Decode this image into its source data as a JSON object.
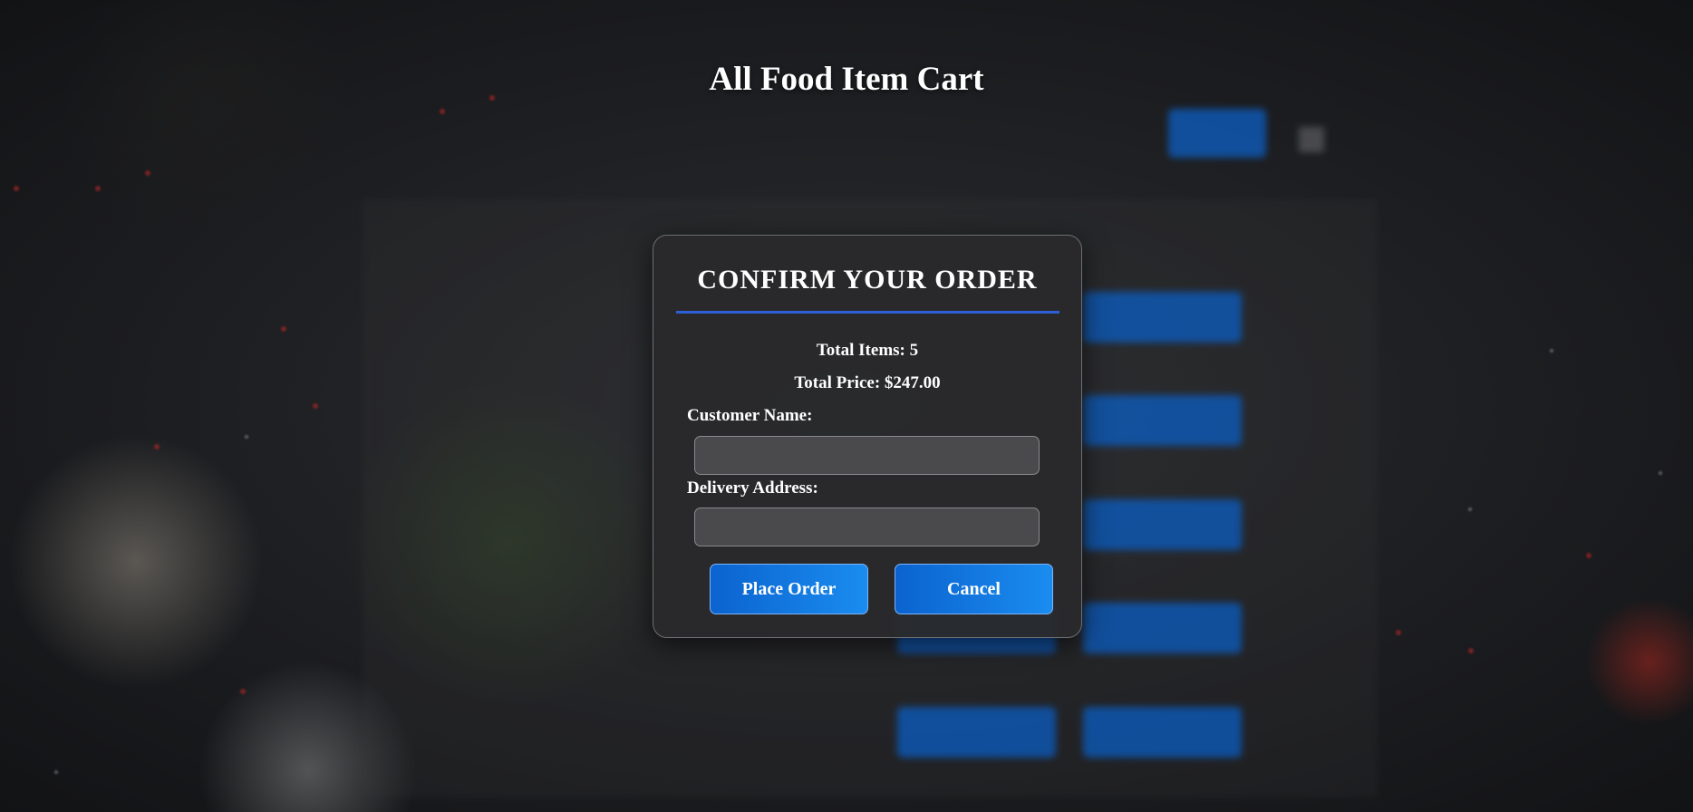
{
  "page": {
    "title": "All Food Item Cart"
  },
  "modal": {
    "title": "CONFIRM YOUR ORDER",
    "total_items_label": "Total Items: 5",
    "total_price_label": "Total Price: $247.00",
    "customer_name_label": "Customer Name:",
    "customer_name_value": "",
    "delivery_address_label": "Delivery Address:",
    "delivery_address_value": "",
    "place_order_label": "Place Order",
    "cancel_label": "Cancel"
  },
  "colors": {
    "accent_blue": "#0b63cf",
    "divider_blue": "#2f5fd6",
    "modal_background": "#2a2a2c"
  }
}
